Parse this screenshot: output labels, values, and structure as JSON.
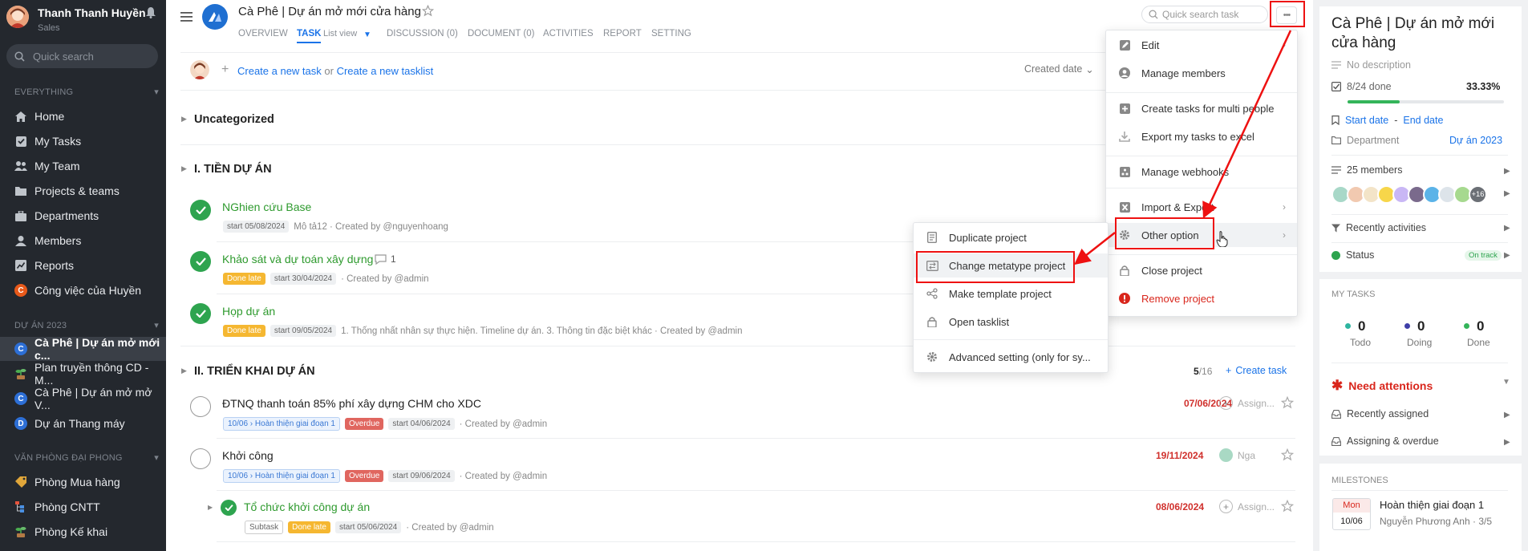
{
  "sidebar": {
    "user_name": "Thanh Thanh Huyền",
    "user_role": "Sales",
    "search_placeholder": "Quick search",
    "section_everything": "EVERYTHING",
    "nav": [
      {
        "label": "Home",
        "icon": "home-icon"
      },
      {
        "label": "My Tasks",
        "icon": "task-check-icon"
      },
      {
        "label": "My Team",
        "icon": "team-icon"
      },
      {
        "label": "Projects & teams",
        "icon": "folder-icon"
      },
      {
        "label": "Departments",
        "icon": "department-icon"
      },
      {
        "label": "Members",
        "icon": "members-icon"
      },
      {
        "label": "Reports",
        "icon": "reports-icon"
      },
      {
        "label": "Công việc của Huyền",
        "icon": "c-badge",
        "badge": "C"
      }
    ],
    "section_projects": "DỰ ÁN 2023",
    "projects": [
      {
        "label": "Cà Phê | Dự án mở mới c...",
        "badge": "C"
      },
      {
        "label": "Plan truyền thông CD - M..."
      },
      {
        "label": "Cà Phê | Dự án mở mở V...",
        "badge": "C"
      },
      {
        "label": "Dự án Thang máy",
        "badge": "D"
      }
    ],
    "section_office": "VĂN PHÒNG ĐẠI PHONG",
    "offices": [
      {
        "label": "Phòng Mua hàng"
      },
      {
        "label": "Phòng CNTT"
      },
      {
        "label": "Phòng Kế khai"
      }
    ]
  },
  "header": {
    "project_title": "Cà Phê | Dự án mở mới cửa hàng",
    "tabs": [
      "OVERVIEW",
      "TASK",
      "List view",
      "DISCUSSION (0)",
      "DOCUMENT (0)",
      "ACTIVITIES",
      "REPORT",
      "SETTING"
    ],
    "search_placeholder": "Quick search task"
  },
  "toolbar": {
    "create_task": "Create a new task",
    "or_text": "or",
    "create_tasklist": "Create a new tasklist",
    "sort_label": "Created date"
  },
  "groups": {
    "uncategorized": "Uncategorized",
    "g1": "I. TIỀN DỰ ÁN",
    "g2": "II. TRIỂN KHAI DỰ ÁN",
    "g2_done": "5",
    "g2_total": "/16",
    "g2_create": "Create task"
  },
  "tasks": [
    {
      "name": "NGhien cứu Base",
      "start": "start 05/08/2024",
      "desc": "Mô tả12 · Created by @nguyenhoang"
    },
    {
      "name": "Khảo sát và dự toán xây dựng",
      "comments": "1",
      "status": "Done late",
      "start": "start 30/04/2024",
      "desc": "· Created by @admin"
    },
    {
      "name": "Họp dự án",
      "status": "Done late",
      "start": "start 09/05/2024",
      "desc": "1. Thống nhất nhân sự thực hiện. Timeline dự án. 3. Thông tin đặc biệt khác · Created by @admin"
    },
    {
      "name": "ĐTNQ thanh toán 85% phí xây dựng CHM cho XDC",
      "milestone": "10/06 › Hoàn thiện giai đoạn 1",
      "status": "Overdue",
      "start": "start 04/06/2024",
      "desc": "· Created by @admin",
      "due": "07/06/2024",
      "assignee": "Assign..."
    },
    {
      "name": "Khởi công",
      "milestone": "10/06 › Hoàn thiện giai đoạn 1",
      "status": "Overdue",
      "start": "start 09/06/2024",
      "desc": "· Created by @admin",
      "due": "19/11/2024",
      "assignee": "Nga"
    },
    {
      "name": "Tổ chức khởi công dự án",
      "subtask": "Subtask",
      "status": "Done late",
      "start": "start 05/06/2024",
      "desc": "· Created by @admin",
      "due": "08/06/2024",
      "assignee": "Assign..."
    }
  ],
  "more_menu": {
    "items": [
      "Edit",
      "Manage members",
      "Create tasks for multi people",
      "Export my tasks to excel",
      "Manage webhooks",
      "Import & Export",
      "Other option",
      "Close project",
      "Remove project"
    ]
  },
  "sub_menu": {
    "items": [
      "Duplicate project",
      "Change metatype project",
      "Make template project",
      "Open tasklist",
      "Advanced setting (only for sy..."
    ]
  },
  "right_panel": {
    "title": "Cà Phê | Dự án mở mới cửa hàng",
    "description": "No description",
    "done_text": "8/24 done",
    "progress_percent": "33.33%",
    "progress_fraction": 0.3333,
    "start_date": "Start date",
    "dash": "-",
    "end_date": "End date",
    "department_label": "Department",
    "department_value": "Dự án 2023",
    "members_label": "25 members",
    "members_more": "+16",
    "recent_activities": "Recently activities",
    "status_label": "Status",
    "status_value": "On track",
    "my_tasks_title": "MY TASKS",
    "todo_count": "0",
    "todo_label": "Todo",
    "doing_count": "0",
    "doing_label": "Doing",
    "done_count": "0",
    "done_label": "Done",
    "need_attentions": "Need attentions",
    "recently_assigned": "Recently assigned",
    "assigning_overdue": "Assigning & overdue",
    "milestones_title": "MILESTONES",
    "ms_day": "Mon",
    "ms_date": "10/06",
    "ms_name": "Hoàn thiện giai đoạn 1",
    "ms_owner": "Nguyễn Phương Anh",
    "ms_count": "3/5"
  },
  "colors": {
    "accent": "#1a73e8",
    "annotation_red": "#e11111",
    "sidebar_bg": "#24282e",
    "done_green": "#2ea44f"
  }
}
